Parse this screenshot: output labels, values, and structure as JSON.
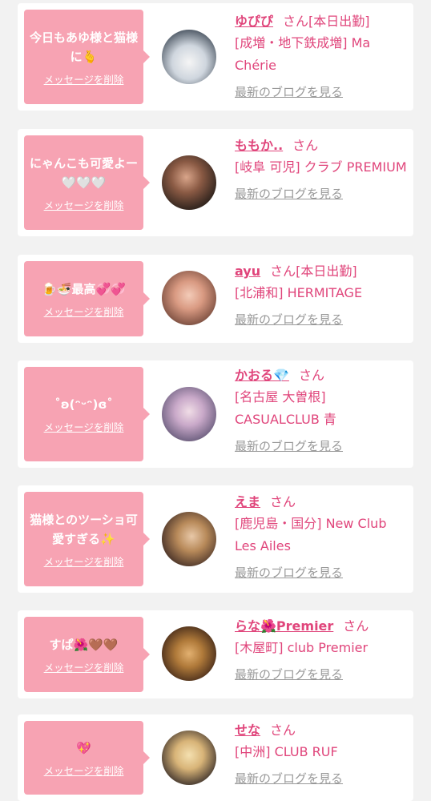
{
  "cards": [
    {
      "message": "今日もあゆ様と猫様に🫰",
      "delete_label": "メッセージを削除",
      "name": "ゆぴぴ",
      "honorific": "さん",
      "status": "[本日出勤]",
      "shop": "[成増・地下鉄成増] Ma Chérie",
      "blog_link": "最新のブログを見る"
    },
    {
      "message": "にゃんこも可愛よー🤍🤍🤍",
      "delete_label": "メッセージを削除",
      "name": "ももか..",
      "honorific": "さん",
      "status": "",
      "shop": "[岐阜 可児] クラブ PREMIUM",
      "blog_link": "最新のブログを見る"
    },
    {
      "message": "🍺🍜最高💞💞",
      "delete_label": "メッセージを削除",
      "name": "ayu",
      "honorific": "さん",
      "status": "[本日出勤]",
      "shop": "[北浦和] HERMITAGE",
      "blog_link": "最新のブログを見る"
    },
    {
      "message": "˚ʚ(ᵔᵕᵔ)ɞ˚",
      "delete_label": "メッセージを削除",
      "name": "かおる💎",
      "honorific": "さん",
      "status": "",
      "shop": "[名古屋 大曽根] CASUALCLUB 青",
      "blog_link": "最新のブログを見る"
    },
    {
      "message": "猫様とのツーショ可愛すぎる✨",
      "delete_label": "メッセージを削除",
      "name": "えま",
      "honorific": "さん",
      "status": "",
      "shop": "[鹿児島・国分] New Club Les Ailes",
      "blog_link": "最新のブログを見る"
    },
    {
      "message": "すぱ🌺🤎🤎",
      "delete_label": "メッセージを削除",
      "name": "らな🌺Premier",
      "honorific": "さん",
      "status": "",
      "shop": "[木屋町] club Premier",
      "blog_link": "最新のブログを見る"
    },
    {
      "message": "💖",
      "delete_label": "メッセージを削除",
      "name": "せな",
      "honorific": "さん",
      "status": "",
      "shop": "[中洲] CLUB RUF",
      "blog_link": "最新のブログを見る"
    }
  ],
  "colors": {
    "bubble": "#f7a3b3",
    "accent": "#e0457b",
    "link_gray": "#999999",
    "background": "#f2f2f2"
  }
}
